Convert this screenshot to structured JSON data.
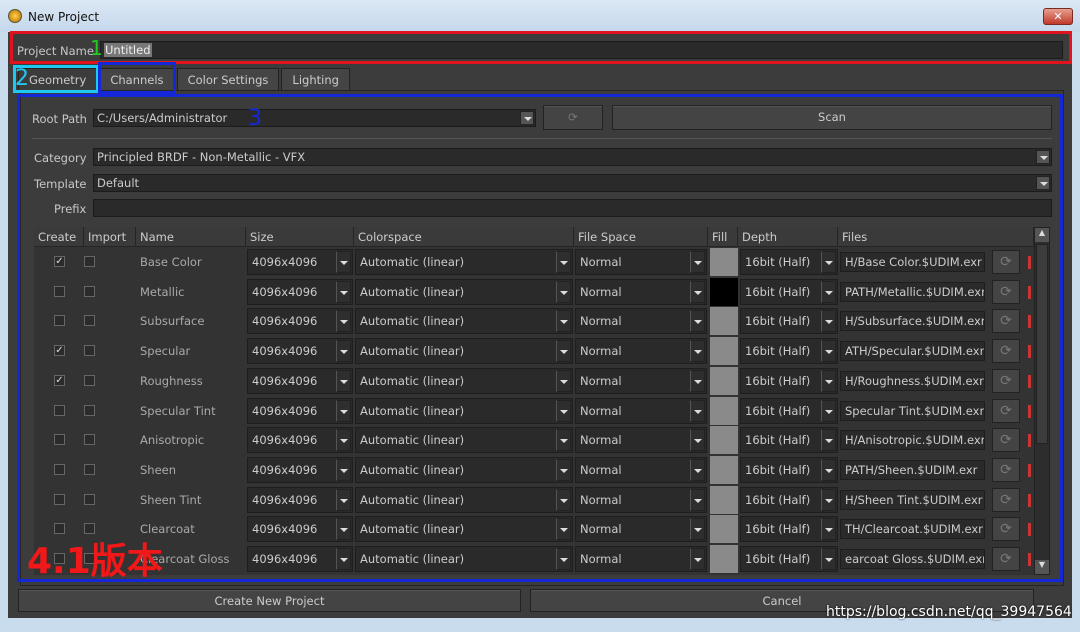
{
  "window": {
    "title": "New Project",
    "close_label": "✕"
  },
  "project_name": {
    "label": "Project Name",
    "value": "Untitled"
  },
  "tabs": [
    {
      "label": "Geometry",
      "active": true
    },
    {
      "label": "Channels"
    },
    {
      "label": "Color Settings"
    },
    {
      "label": "Lighting"
    }
  ],
  "root_path": {
    "label": "Root Path",
    "value": "C:/Users/Administrator",
    "scan_label": "Scan"
  },
  "category": {
    "label": "Category",
    "value": "Principled BRDF - Non-Metallic - VFX"
  },
  "template": {
    "label": "Template",
    "value": "Default"
  },
  "prefix": {
    "label": "Prefix",
    "value": ""
  },
  "table": {
    "columns": [
      "Create",
      "Import",
      "Name",
      "Size",
      "Colorspace",
      "File Space",
      "Fill",
      "Depth",
      "Files"
    ],
    "rows": [
      {
        "create": true,
        "import": false,
        "name": "Base Color",
        "size": "4096x4096",
        "colorspace": "Automatic (linear)",
        "filespace": "Normal",
        "fill": "#8a8a8a",
        "depth": "16bit (Half)",
        "file": "H/Base Color.$UDIM.exr"
      },
      {
        "create": false,
        "import": false,
        "name": "Metallic",
        "size": "4096x4096",
        "colorspace": "Automatic (linear)",
        "filespace": "Normal",
        "fill": "#000000",
        "depth": "16bit (Half)",
        "file": "PATH/Metallic.$UDIM.exr"
      },
      {
        "create": false,
        "import": false,
        "name": "Subsurface",
        "size": "4096x4096",
        "colorspace": "Automatic (linear)",
        "filespace": "Normal",
        "fill": "#8a8a8a",
        "depth": "16bit (Half)",
        "file": "H/Subsurface.$UDIM.exr"
      },
      {
        "create": true,
        "import": false,
        "name": "Specular",
        "size": "4096x4096",
        "colorspace": "Automatic (linear)",
        "filespace": "Normal",
        "fill": "#8a8a8a",
        "depth": "16bit (Half)",
        "file": "ATH/Specular.$UDIM.exr"
      },
      {
        "create": true,
        "import": false,
        "name": "Roughness",
        "size": "4096x4096",
        "colorspace": "Automatic (linear)",
        "filespace": "Normal",
        "fill": "#8a8a8a",
        "depth": "16bit (Half)",
        "file": "H/Roughness.$UDIM.exr"
      },
      {
        "create": false,
        "import": false,
        "name": "Specular Tint",
        "size": "4096x4096",
        "colorspace": "Automatic (linear)",
        "filespace": "Normal",
        "fill": "#8a8a8a",
        "depth": "16bit (Half)",
        "file": "Specular Tint.$UDIM.exr"
      },
      {
        "create": false,
        "import": false,
        "name": "Anisotropic",
        "size": "4096x4096",
        "colorspace": "Automatic (linear)",
        "filespace": "Normal",
        "fill": "#8a8a8a",
        "depth": "16bit (Half)",
        "file": "H/Anisotropic.$UDIM.exr"
      },
      {
        "create": false,
        "import": false,
        "name": "Sheen",
        "size": "4096x4096",
        "colorspace": "Automatic (linear)",
        "filespace": "Normal",
        "fill": "#8a8a8a",
        "depth": "16bit (Half)",
        "file": "PATH/Sheen.$UDIM.exr"
      },
      {
        "create": false,
        "import": false,
        "name": "Sheen Tint",
        "size": "4096x4096",
        "colorspace": "Automatic (linear)",
        "filespace": "Normal",
        "fill": "#8a8a8a",
        "depth": "16bit (Half)",
        "file": "H/Sheen Tint.$UDIM.exr"
      },
      {
        "create": false,
        "import": false,
        "name": "Clearcoat",
        "size": "4096x4096",
        "colorspace": "Automatic (linear)",
        "filespace": "Normal",
        "fill": "#8a8a8a",
        "depth": "16bit (Half)",
        "file": "TH/Clearcoat.$UDIM.exr"
      },
      {
        "create": false,
        "import": false,
        "name": "Clearcoat Gloss",
        "size": "4096x4096",
        "colorspace": "Automatic (linear)",
        "filespace": "Normal",
        "fill": "#8a8a8a",
        "depth": "16bit (Half)",
        "file": "earcoat Gloss.$UDIM.exr"
      }
    ]
  },
  "footer": {
    "create_label": "Create New Project",
    "cancel_label": "Cancel"
  },
  "annotations": {
    "n1": "1",
    "n2": "2",
    "n3": "3",
    "version": "4.1版本",
    "watermark": "https://blog.csdn.net/qq_39947564"
  },
  "colors": {
    "annot_red": "#e0141e",
    "annot_blue": "#1428d8",
    "annot_cyan": "#1ec8f0",
    "annot_green": "#22cc22"
  }
}
